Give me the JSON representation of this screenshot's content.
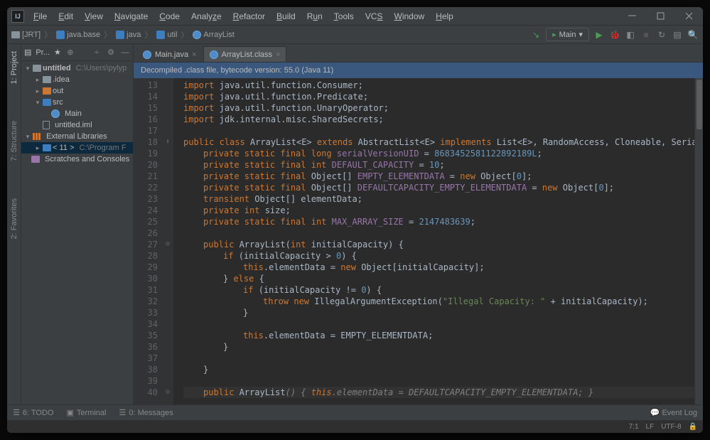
{
  "menu": {
    "file": "File",
    "edit": "Edit",
    "view": "View",
    "navigate": "Navigate",
    "code": "Code",
    "analyze": "Analyze",
    "refactor": "Refactor",
    "build": "Build",
    "run": "Run",
    "tools": "Tools",
    "vcs": "VCS",
    "window": "Window",
    "help": "Help"
  },
  "breadcrumbs": {
    "jrt": "[JRT]",
    "jb": "java.base",
    "j": "java",
    "u": "util",
    "cl": "ArrayList"
  },
  "nav": {
    "config": "Main",
    "dd": "▾"
  },
  "sidebar": {
    "title": "Pr...",
    "star": "★",
    "items": {
      "untitled": "untitled",
      "untitled_path": "C:\\Users\\pylyp",
      "idea": ".idea",
      "out": "out",
      "src": "src",
      "main": "Main",
      "iml": "untitled.iml",
      "extlib": "External Libraries",
      "jdk": "< 11 >",
      "jdk_path": "C:\\Program F",
      "scratch": "Scratches and Consoles"
    }
  },
  "tabs": {
    "main": "Main.java",
    "arr": "ArrayList.class",
    "close": "×"
  },
  "banner": "Decompiled .class file, bytecode version: 55.0 (Java 11)",
  "gutter": [
    "13",
    "14",
    "15",
    "16",
    "17",
    "18",
    "19",
    "20",
    "21",
    "22",
    "23",
    "24",
    "25",
    "26",
    "27",
    "28",
    "29",
    "30",
    "31",
    "32",
    "33",
    "34",
    "35",
    "36",
    "37",
    "38",
    "39",
    "40"
  ],
  "marks": {
    "l18": "⬇",
    "l27": "⊖",
    "l40": "⊖"
  },
  "code": {
    "l13": {
      "kw": "import",
      "t": "java.util.function.Consumer;"
    },
    "l14": {
      "kw": "import",
      "t": "java.util.function.Predicate;"
    },
    "l15": {
      "kw": "import",
      "t": "java.util.function.UnaryOperator;"
    },
    "l16": {
      "kw": "import",
      "t": "jdk.internal.misc.SharedSecrets;"
    },
    "l18": {
      "a": "public class ",
      "b": "ArrayList",
      "c": "<",
      "d": "E",
      "e": "> ",
      "f": "extends ",
      "g": "AbstractList",
      "h": "<",
      "i": "E",
      "j": "> ",
      "k": "implements ",
      "l": "List",
      "m": "<",
      "n": "E",
      "o": ">, RandomAccess, Cloneable, Serializable {"
    },
    "l19": {
      "mod": "private static final long ",
      "id": "serialVersionUID",
      "eq": " = ",
      "val": "8683452581122892189L",
      "sc": ";"
    },
    "l20": {
      "mod": "private static final int ",
      "id": "DEFAULT_CAPACITY",
      "eq": " = ",
      "val": "10",
      "sc": ";"
    },
    "l21": {
      "mod": "private static final ",
      "t": "Object[] ",
      "id": "EMPTY_ELEMENTDATA",
      "eq": " = ",
      "kw": "new ",
      "t2": "Object[",
      "val": "0",
      "t3": "];"
    },
    "l22": {
      "mod": "private static final ",
      "t": "Object[] ",
      "id": "DEFAULTCAPACITY_EMPTY_ELEMENTDATA",
      "eq": " = ",
      "kw": "new ",
      "t2": "Object[",
      "val": "0",
      "t3": "];"
    },
    "l23": {
      "mod": "transient ",
      "t": "Object[] ",
      "id": "elementData;"
    },
    "l24": {
      "mod": "private int ",
      "id": "size;"
    },
    "l25": {
      "mod": "private static final int ",
      "id": "MAX_ARRAY_SIZE",
      "eq": " = ",
      "val": "2147483639",
      "sc": ";"
    },
    "l27": {
      "mod": "public ",
      "n": "ArrayList",
      "p": "(",
      "kw": "int ",
      "id": "initialCapacity) {"
    },
    "l28": {
      "kw": "if ",
      "t": "(initialCapacity > ",
      "val": "0",
      "t2": ") {"
    },
    "l29": {
      "kw": "this",
      "t": ".elementData = ",
      "kw2": "new ",
      "t2": "Object[initialCapacity];"
    },
    "l30": {
      "t": "} ",
      "kw": "else ",
      "t2": "{"
    },
    "l31": {
      "kw": "if ",
      "t": "(initialCapacity != ",
      "val": "0",
      "t2": ") {"
    },
    "l32": {
      "kw": "throw new ",
      "t": "IllegalArgumentException(",
      "str": "\"Illegal Capacity: \"",
      "t2": " + initialCapacity);"
    },
    "l33": {
      "t": "}"
    },
    "l35": {
      "kw": "this",
      "t": ".elementData = EMPTY_ELEMENTDATA;"
    },
    "l36": {
      "t": "}"
    },
    "l38": {
      "t": "}"
    },
    "l40": {
      "mod": "public ",
      "n": "ArrayList",
      "p": "() { ",
      "kw": "this",
      "t": ".elementData = DEFAULTCAPACITY_EMPTY_ELEMENTDATA; }"
    }
  },
  "statusbar": {
    "todo": "6: TODO",
    "terminal": "Terminal",
    "messages": "0: Messages",
    "eventlog": "Event Log"
  },
  "footer": {
    "pos": "7:1",
    "lf": "LF",
    "enc": "UTF-8"
  },
  "vtabs": {
    "project": "1: Project",
    "structure": "7: Structure",
    "favorites": "2: Favorites"
  }
}
